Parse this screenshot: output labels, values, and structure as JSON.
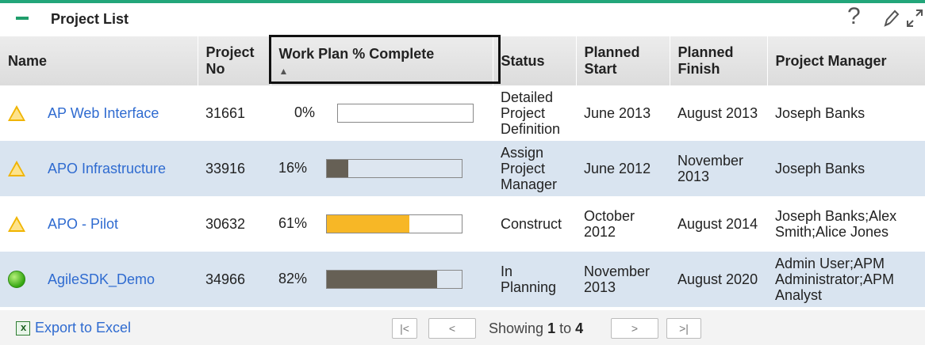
{
  "portlet": {
    "title": "Project List",
    "help_glyph": "?",
    "tools": [
      "help-icon",
      "pencil-icon",
      "expand-icon"
    ]
  },
  "columns": {
    "name": "Name",
    "project_no": "Project No",
    "work_plan": "Work Plan % Complete",
    "status": "Status",
    "planned_start": "Planned Start",
    "planned_finish": "Planned Finish",
    "project_manager": "Project Manager",
    "sort_indicator": "▲"
  },
  "rows": [
    {
      "indicator": "warning-triangle-icon",
      "name": "AP Web Interface",
      "project_no": "31661",
      "pct_label": "0%",
      "pct": 0,
      "bar_color": "#ffffff",
      "status": "Detailed Project Definition",
      "planned_start": "June 2013",
      "planned_finish": "August 2013",
      "manager": "Joseph Banks"
    },
    {
      "indicator": "warning-triangle-icon",
      "name": "APO Infrastructure",
      "project_no": "33916",
      "pct_label": "16%",
      "pct": 16,
      "bar_color": "#666055",
      "status": "Assign Project Manager",
      "planned_start": "June 2012",
      "planned_finish": "November 2013",
      "manager": "Joseph Banks"
    },
    {
      "indicator": "warning-triangle-icon",
      "name": "APO - Pilot",
      "project_no": "30632",
      "pct_label": "61%",
      "pct": 61,
      "bar_color": "#f7b726",
      "status": "Construct",
      "planned_start": "October 2012",
      "planned_finish": "August 2014",
      "manager": "Joseph Banks;Alex Smith;Alice Jones"
    },
    {
      "indicator": "green-circle-icon",
      "name": "AgileSDK_Demo",
      "project_no": "34966",
      "pct_label": "82%",
      "pct": 82,
      "bar_color": "#666055",
      "status": "In Planning",
      "planned_start": "November 2013",
      "planned_finish": "August 2020",
      "manager": "Admin User;APM Administrator;APM Analyst"
    }
  ],
  "footer": {
    "export_label": "Export to Excel",
    "showing_prefix": "Showing ",
    "showing_from": "1",
    "showing_to_word": " to ",
    "showing_to": "4",
    "first_glyph": "|<",
    "prev_glyph": "<",
    "next_glyph": ">",
    "last_glyph": ">|"
  },
  "colors": {
    "accent": "#22a67a",
    "link": "#2f6bd0",
    "alt_row": "#d9e4f0"
  }
}
